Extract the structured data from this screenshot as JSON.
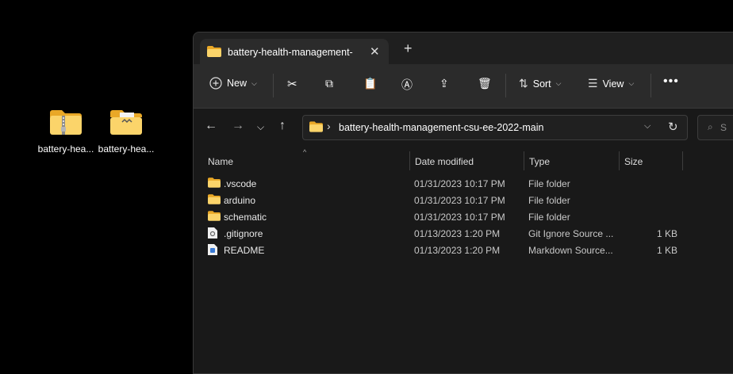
{
  "desktop": {
    "icons": [
      {
        "label": "battery-hea...",
        "icon": "zip-folder-icon"
      },
      {
        "label": "battery-hea...",
        "icon": "folder-with-document-icon"
      }
    ]
  },
  "explorer": {
    "tab_title": "battery-health-management-",
    "toolbar": {
      "new_label": "New",
      "sort_label": "Sort",
      "view_label": "View"
    },
    "address": {
      "path": "battery-health-management-csu-ee-2022-main"
    },
    "search": {
      "placeholder": "S"
    },
    "columns": {
      "name": "Name",
      "date": "Date modified",
      "type": "Type",
      "size": "Size"
    },
    "files": [
      {
        "name": ".vscode",
        "date": "01/31/2023 10:17 PM",
        "type": "File folder",
        "size": "",
        "icon": "folder-icon"
      },
      {
        "name": "arduino",
        "date": "01/31/2023 10:17 PM",
        "type": "File folder",
        "size": "",
        "icon": "folder-icon"
      },
      {
        "name": "schematic",
        "date": "01/31/2023 10:17 PM",
        "type": "File folder",
        "size": "",
        "icon": "folder-icon"
      },
      {
        "name": ".gitignore",
        "date": "01/13/2023 1:20 PM",
        "type": "Git Ignore Source ...",
        "size": "1 KB",
        "icon": "gitignore-file-icon"
      },
      {
        "name": "README",
        "date": "01/13/2023 1:20 PM",
        "type": "Markdown Source...",
        "size": "1 KB",
        "icon": "markdown-file-icon"
      }
    ]
  },
  "colors": {
    "accent": "#f7c948",
    "background": "#000000",
    "window": "#191919"
  }
}
